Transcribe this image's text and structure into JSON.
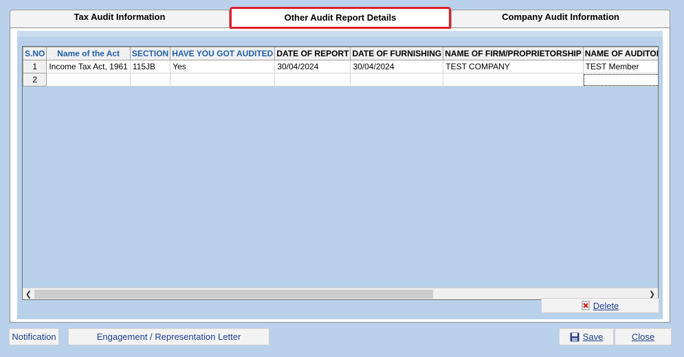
{
  "tabs": [
    {
      "label": "Tax Audit Information"
    },
    {
      "label": "Other Audit Report Details"
    },
    {
      "label": "Company Audit Information"
    }
  ],
  "grid": {
    "columns": [
      "S.NO",
      "Name of the Act",
      "SECTION",
      "HAVE YOU GOT AUDITED",
      "DATE OF REPORT",
      "DATE OF FURNISHING",
      "NAME OF FIRM/PROPRIETORSHIP",
      "NAME OF AUDITOR"
    ],
    "rows": [
      {
        "sno": "1",
        "act": "Income Tax Act, 1961",
        "section": "115JB",
        "audited": "Yes",
        "date_report": "30/04/2024",
        "date_furnishing": "30/04/2024",
        "firm": "TEST COMPANY",
        "auditor": "TEST Member"
      },
      {
        "sno": "2",
        "act": "",
        "section": "",
        "audited": "",
        "date_report": "",
        "date_furnishing": "",
        "firm": "",
        "auditor": ""
      }
    ]
  },
  "buttons": {
    "delete": "Delete",
    "notification": "Notification",
    "engagement": "Engagement / Representation Letter",
    "save": "Save",
    "close": "Close"
  },
  "colors": {
    "background": "#b9d1ea",
    "active_tab_border": "#e0202a",
    "blue_header_text": "#1f5fa8",
    "button_text": "#1b3f8f"
  }
}
